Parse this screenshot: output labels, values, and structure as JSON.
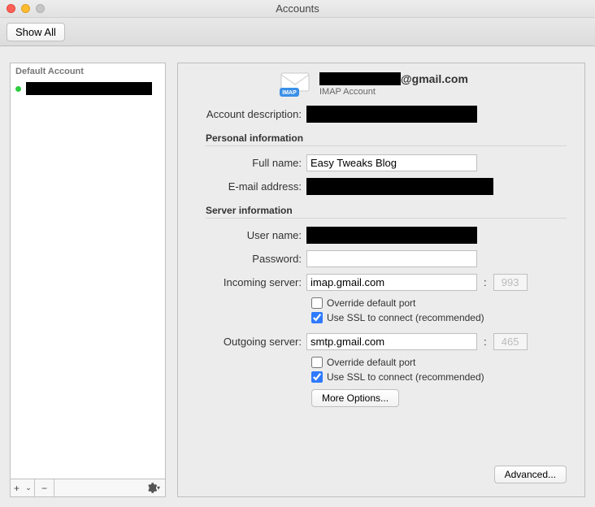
{
  "window": {
    "title": "Accounts"
  },
  "toolbar": {
    "show_all": "Show All"
  },
  "sidebar": {
    "header": "Default Account",
    "items": [
      {
        "label": "████████████"
      }
    ],
    "footer": {
      "add": "+",
      "add_menu": "⌄",
      "remove": "−",
      "settings": "⚙"
    }
  },
  "main": {
    "account_email_suffix": "@gmail.com",
    "account_type": "IMAP Account",
    "fields": {
      "description_label": "Account description:",
      "personal_header": "Personal information",
      "full_name_label": "Full name:",
      "full_name_value": "Easy Tweaks Blog",
      "email_label": "E-mail address:",
      "server_header": "Server information",
      "user_name_label": "User name:",
      "password_label": "Password:",
      "password_value": "",
      "incoming_label": "Incoming server:",
      "incoming_value": "imap.gmail.com",
      "incoming_port": "993",
      "outgoing_label": "Outgoing server:",
      "outgoing_value": "smtp.gmail.com",
      "outgoing_port": "465",
      "override_port": "Override default port",
      "use_ssl": "Use SSL to connect (recommended)",
      "more_options": "More Options...",
      "advanced": "Advanced..."
    }
  }
}
